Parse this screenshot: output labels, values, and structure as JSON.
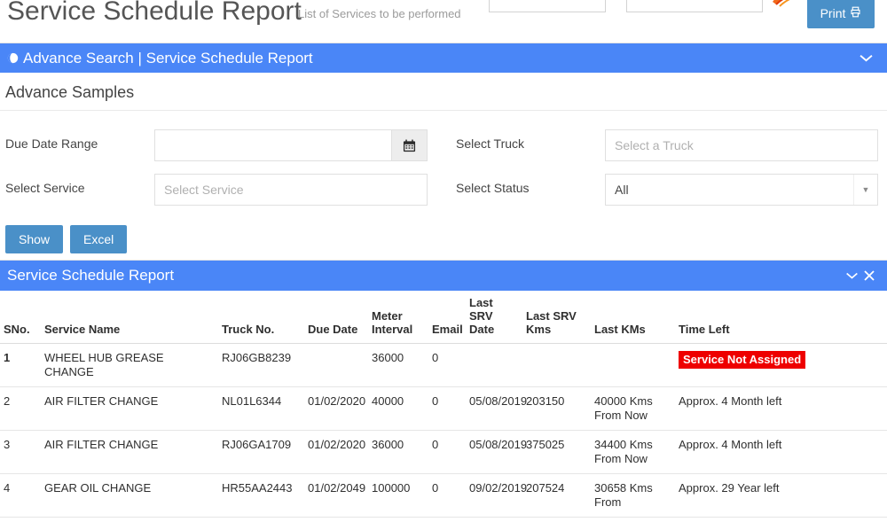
{
  "header": {
    "title": "Service Schedule Report",
    "subtitle": "List of Services to be performed",
    "print_label": "Print",
    "print_icon": "printer-icon",
    "field_one_value": "",
    "field_two_value": "",
    "logo": "orange-logo-icon"
  },
  "search_panel": {
    "banner_icon": "globe-icon",
    "banner_title": "Advance Search | Service Schedule Report",
    "collapse_icon": "chevron-down-icon",
    "section_heading": "Advance Samples",
    "fields": {
      "due_date_label": "Due Date Range",
      "due_date_value": "",
      "due_date_placeholder": "",
      "calendar_icon": "calendar-icon",
      "service_label": "Select Service",
      "service_value": "",
      "service_placeholder": "Select Service",
      "truck_label": "Select Truck",
      "truck_value": "",
      "truck_placeholder": "Select a Truck",
      "status_label": "Select Status",
      "status_value": "All",
      "status_caret": "caret-down-icon"
    },
    "buttons": {
      "show": "Show",
      "excel": "Excel"
    }
  },
  "report_panel": {
    "banner_title": "Service Schedule Report",
    "collapse_icon": "chevron-down-icon",
    "close_icon": "close-icon",
    "columns": {
      "sno": "SNo.",
      "service_name": "Service Name",
      "truck_no": "Truck No.",
      "due_date": "Due Date",
      "meter_interval_1": "Meter",
      "meter_interval_2": "Interval",
      "email": "Email",
      "last_srv_date_1": "Last SRV",
      "last_srv_date_2": "Date",
      "last_srv_kms_1": "Last SRV",
      "last_srv_kms_2": "Kms",
      "last_kms": "Last KMs",
      "time_left": "Time Left"
    },
    "rows": [
      {
        "sno": "1",
        "service_name": "WHEEL HUB GREASE CHANGE",
        "truck_no": "RJ06GB8239",
        "due_date": "",
        "meter_interval": "36000",
        "email": "0",
        "last_srv_date": "",
        "last_srv_kms": "",
        "last_kms": "",
        "time_left": "",
        "badge": "Service Not Assigned",
        "badge_color": "#ee0000"
      },
      {
        "sno": "2",
        "service_name": "AIR FILTER CHANGE",
        "truck_no": "NL01L6344",
        "due_date": "01/02/2020",
        "meter_interval": "40000",
        "email": "0",
        "last_srv_date": "05/08/2019",
        "last_srv_kms": "203150",
        "last_kms": "40000 Kms From Now",
        "time_left": "Approx. 4 Month left",
        "badge": "",
        "badge_color": ""
      },
      {
        "sno": "3",
        "service_name": "AIR FILTER CHANGE",
        "truck_no": "RJ06GA1709",
        "due_date": "01/02/2020",
        "meter_interval": "36000",
        "email": "0",
        "last_srv_date": "05/08/2019",
        "last_srv_kms": "375025",
        "last_kms": "34400 Kms From Now",
        "time_left": "Approx. 4 Month left",
        "badge": "",
        "badge_color": ""
      },
      {
        "sno": "4",
        "service_name": "GEAR OIL CHANGE",
        "truck_no": "HR55AA2443",
        "due_date": "01/02/2049",
        "meter_interval": "100000",
        "email": "0",
        "last_srv_date": "09/02/2019",
        "last_srv_kms": "207524",
        "last_kms": "30658 Kms From",
        "time_left": "Approx. 29 Year left",
        "badge": "",
        "badge_color": ""
      }
    ]
  },
  "colors": {
    "banner_blue": "#4a86f7",
    "button_blue": "#4a90c8",
    "danger_red": "#ee0000"
  }
}
